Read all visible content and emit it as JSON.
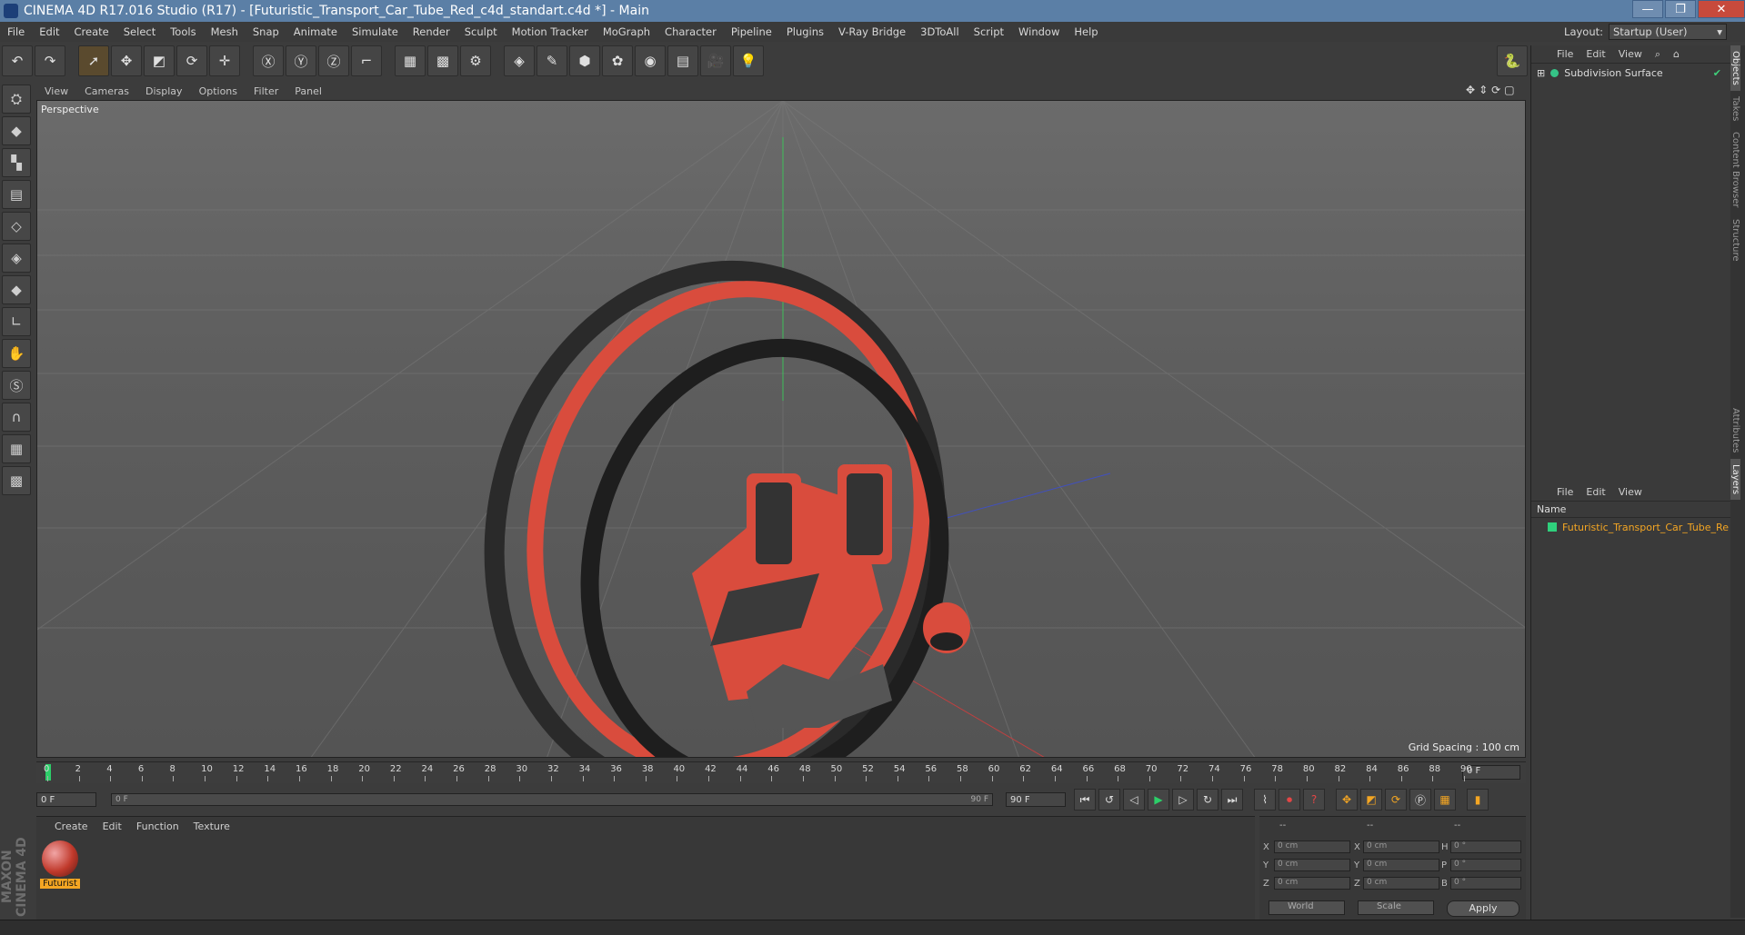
{
  "window": {
    "title": "CINEMA 4D R17.016 Studio (R17) - [Futuristic_Transport_Car_Tube_Red_c4d_standart.c4d *] - Main"
  },
  "menu": [
    "File",
    "Edit",
    "Create",
    "Select",
    "Tools",
    "Mesh",
    "Snap",
    "Animate",
    "Simulate",
    "Render",
    "Sculpt",
    "Motion Tracker",
    "MoGraph",
    "Character",
    "Pipeline",
    "Plugins",
    "V-Ray Bridge",
    "3DToAll",
    "Script",
    "Window",
    "Help"
  ],
  "layout": {
    "label": "Layout:",
    "value": "Startup (User)"
  },
  "viewport": {
    "menu": [
      "View",
      "Cameras",
      "Display",
      "Options",
      "Filter",
      "Panel"
    ],
    "camera": "Perspective",
    "grid_spacing": "Grid Spacing : 100 cm"
  },
  "objects_panel": {
    "menu": [
      "File",
      "Edit",
      "View"
    ],
    "items": [
      {
        "name": "Subdivision Surface"
      }
    ]
  },
  "layers_panel": {
    "menu": [
      "File",
      "Edit",
      "View"
    ],
    "column": "Name",
    "items": [
      {
        "name": "Futuristic_Transport_Car_Tube_Re",
        "color": "#2fd07c"
      }
    ]
  },
  "side_tabs": [
    "Objects",
    "Takes",
    "Content Browser",
    "Structure",
    "Attributes",
    "Layers"
  ],
  "timeline": {
    "ticks": [
      "0",
      "2",
      "4",
      "6",
      "8",
      "10",
      "12",
      "14",
      "16",
      "18",
      "20",
      "22",
      "24",
      "26",
      "28",
      "30",
      "32",
      "34",
      "36",
      "38",
      "40",
      "42",
      "44",
      "46",
      "48",
      "50",
      "52",
      "54",
      "56",
      "58",
      "60",
      "62",
      "64",
      "66",
      "68",
      "70",
      "72",
      "74",
      "76",
      "78",
      "80",
      "82",
      "84",
      "86",
      "88",
      "90"
    ],
    "current": "0 F",
    "start": "0 F",
    "slider_start": "0 F",
    "slider_end": "90 F",
    "end": "90 F"
  },
  "material_panel": {
    "menu": [
      "Create",
      "Edit",
      "Function",
      "Texture"
    ],
    "materials": [
      {
        "name": "Futurist"
      }
    ]
  },
  "coords": {
    "headers": [
      "--",
      "--",
      "--"
    ],
    "rows": [
      {
        "a": "X",
        "av": "0 cm",
        "b": "X",
        "bv": "0 cm",
        "c": "H",
        "cv": "0 °"
      },
      {
        "a": "Y",
        "av": "0 cm",
        "b": "Y",
        "bv": "0 cm",
        "c": "P",
        "cv": "0 °"
      },
      {
        "a": "Z",
        "av": "0 cm",
        "b": "Z",
        "bv": "0 cm",
        "c": "B",
        "cv": "0 °"
      }
    ],
    "mode": "World",
    "scale": "Scale",
    "apply": "Apply"
  },
  "brand": "MAXON CINEMA 4D"
}
